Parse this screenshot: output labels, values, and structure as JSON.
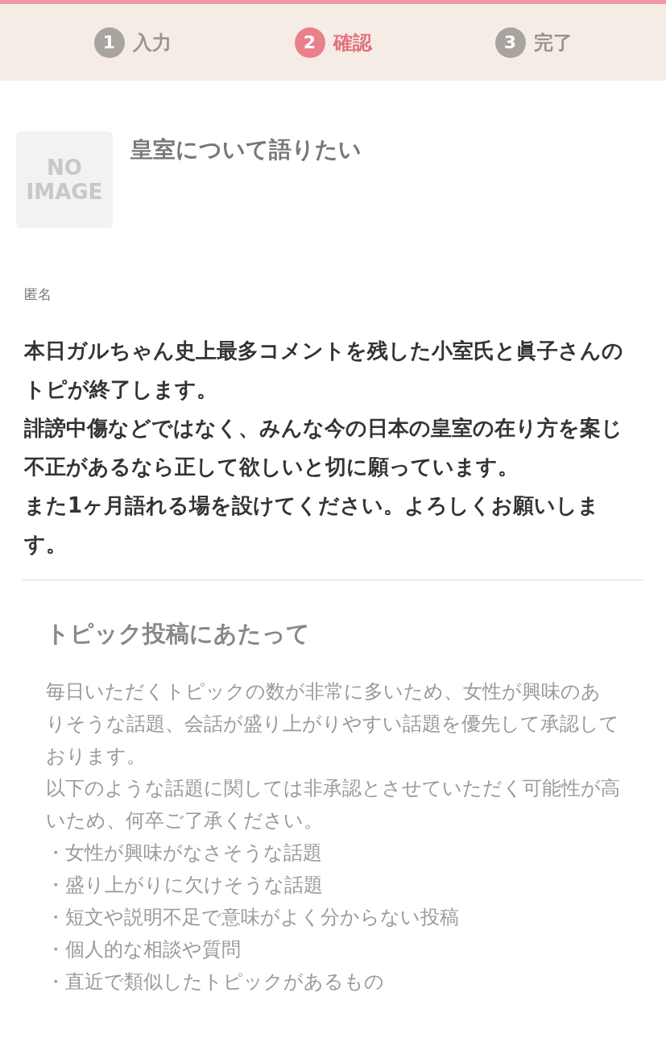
{
  "steps": [
    {
      "number": "1",
      "label": "入力",
      "selected": false
    },
    {
      "number": "2",
      "label": "確認",
      "selected": true
    },
    {
      "number": "3",
      "label": "完了",
      "selected": false
    }
  ],
  "topic": {
    "thumbnail_text": "NO IMAGE",
    "title": "皇室について語りたい",
    "author": "匿名",
    "body": [
      "本日ガルちゃん史上最多コメントを残した小室氏と眞子さんのトピが終了します。",
      "誹謗中傷などではなく、みんな今の日本の皇室の在り方を案じ不正があるなら正して欲しいと切に願っています。",
      "また1ヶ月語れる場を設けてください。よろしくお願いします。"
    ]
  },
  "guidelines": {
    "heading": "トピック投稿にあたって",
    "paragraphs": [
      "毎日いただくトピックの数が非常に多いため、女性が興味のありそうな話題、会話が盛り上がりやすい話題を優先して承認しております。",
      "以下のような話題に関しては非承認とさせていただく可能性が高いため、何卒ご了承ください。"
    ],
    "items": [
      "・女性が興味がなさそうな話題",
      "・盛り上がりに欠けそうな話題",
      "・短文や説明不足で意味がよく分からない投稿",
      "・個人的な相談や質問",
      "・直近で類似したトピックがあるもの"
    ]
  }
}
